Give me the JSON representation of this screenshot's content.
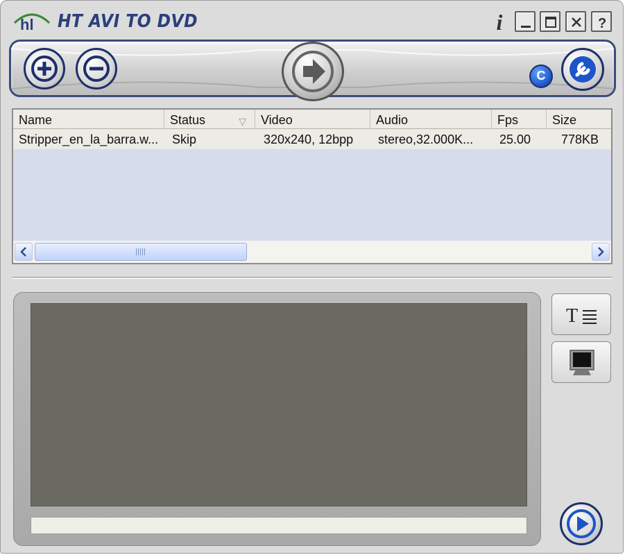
{
  "window": {
    "title": "HT AVI TO DVD",
    "logo_text": "hl",
    "info_icon": "i",
    "help_label": "?"
  },
  "toolbar": {
    "add_icon": "plus-icon",
    "remove_icon": "minus-icon",
    "convert_icon": "arrow-right-icon",
    "c_label": "C",
    "settings_icon": "wrench-icon"
  },
  "file_list": {
    "columns": [
      {
        "label": "Name"
      },
      {
        "label": "Status",
        "sort_indicator": "▽"
      },
      {
        "label": "Video"
      },
      {
        "label": "Audio"
      },
      {
        "label": "Fps"
      },
      {
        "label": "Size"
      }
    ],
    "rows": [
      {
        "name": "Stripper_en_la_barra.w...",
        "status": "Skip",
        "video": "320x240, 12bpp",
        "audio": "stereo,32.000K...",
        "fps": "25.00",
        "size": "778KB"
      }
    ],
    "scrollbar_position": 0.0
  },
  "preview": {
    "screen_color": "#6a6a60",
    "status_text": ""
  },
  "side_buttons": {
    "subtitle_label": "T",
    "monitor_icon": "monitor-icon",
    "play_icon": "play-icon"
  },
  "colors": {
    "accent": "#1d2f6a",
    "title": "#2b3f7a",
    "logo": "#3a8a3a",
    "list_bg": "#d6dcec",
    "row_bg": "#ecebe5"
  }
}
